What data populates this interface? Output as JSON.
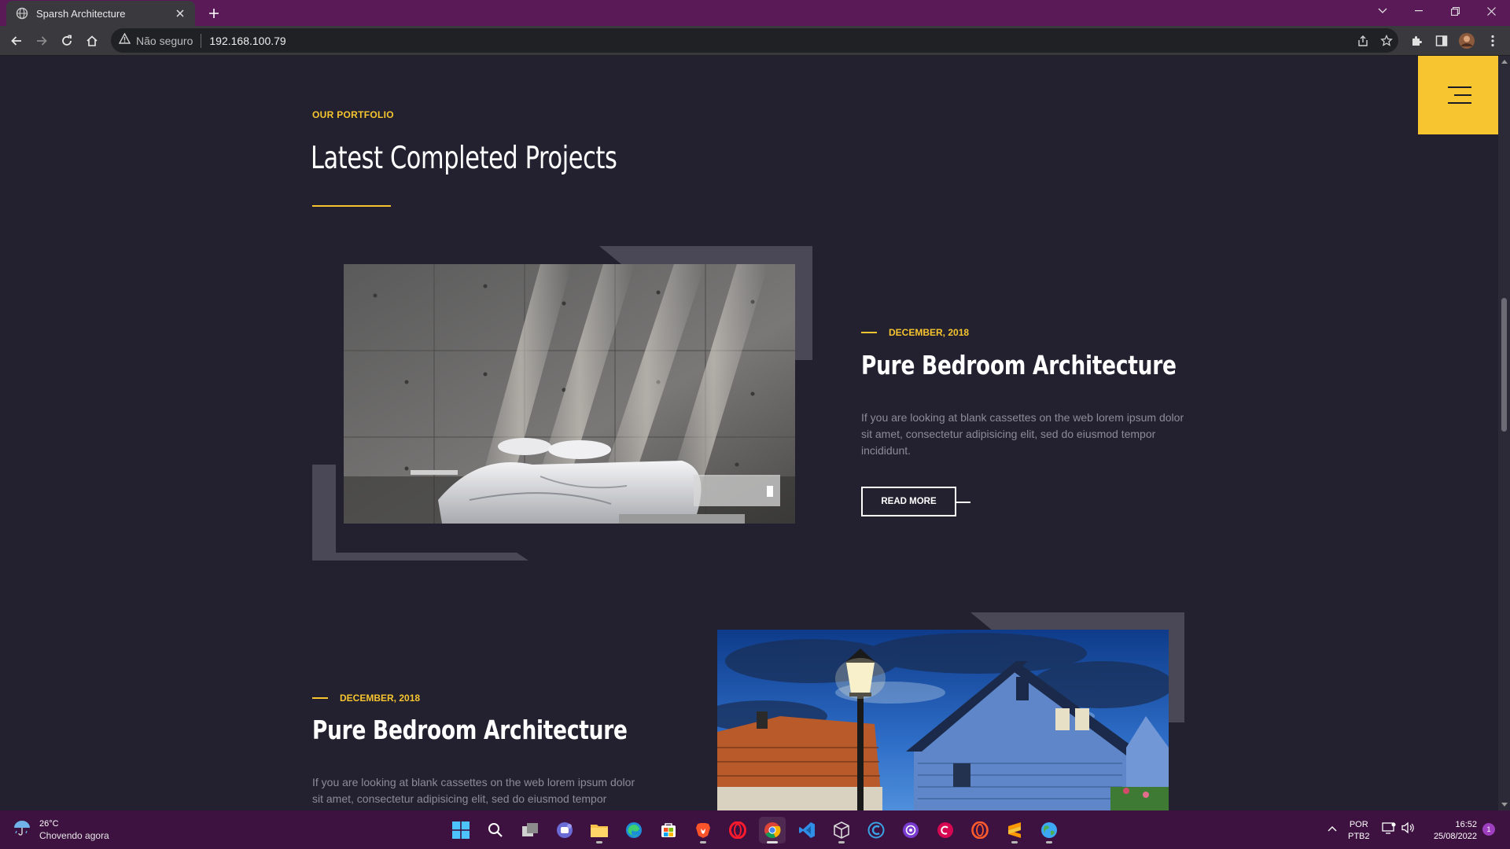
{
  "browser": {
    "tab_title": "Sparsh Architecture",
    "security_label": "Não seguro",
    "url": "192.168.100.79"
  },
  "page": {
    "eyebrow": "OUR PORTFOLIO",
    "section_title": "Latest Completed Projects",
    "projects": [
      {
        "date": "DECEMBER, 2018",
        "title": "Pure Bedroom Architecture",
        "text": "If you are looking at blank cassettes on the web lorem ipsum dolor sit amet, consectetur adipisicing elit, sed do eiusmod tempor incididunt.",
        "button": "READ MORE"
      },
      {
        "date": "DECEMBER, 2018",
        "title": "Pure Bedroom Architecture",
        "text": "If you are looking at blank cassettes on the web lorem ipsum dolor sit amet, consectetur adipisicing elit, sed do eiusmod tempor incididunt."
      }
    ]
  },
  "taskbar": {
    "weather_temp": "26°C",
    "weather_condition": "Chovendo agora",
    "lang_top": "POR",
    "lang_bottom": "PTB2",
    "time": "16:52",
    "date": "25/08/2022",
    "notification_count": "1",
    "apps": [
      "start",
      "search",
      "task-view",
      "teams-chat",
      "file-explorer",
      "edge",
      "microsoft-store",
      "brave",
      "opera",
      "chrome",
      "vscode",
      "virtualbox",
      "ccleaner",
      "podcast-app",
      "debian",
      "opera-gx",
      "sublime",
      "cortana-globe"
    ]
  },
  "colors": {
    "accent": "#f6c52f",
    "page_bg": "#23212f",
    "tabstrip": "#5a1a57",
    "taskbar": "#3d1140"
  }
}
